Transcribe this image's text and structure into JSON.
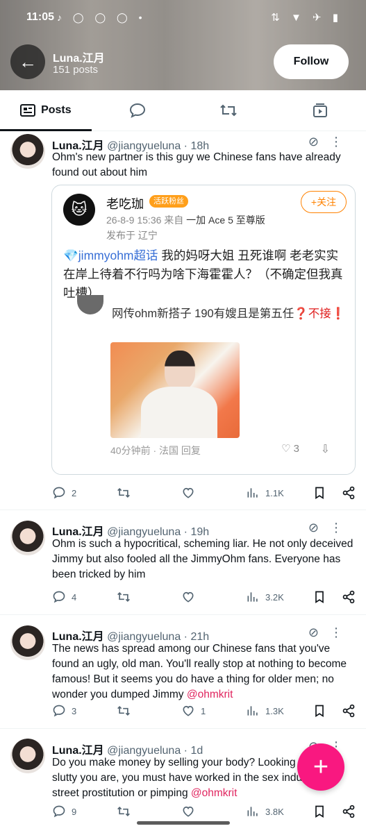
{
  "status_bar": {
    "time": "11:05",
    "apps": "♪ ◯ ◯ ◯ •",
    "right": "⇅ ▼ ✈ ▮"
  },
  "header": {
    "name": "Luna.江月",
    "posts": "151 posts",
    "follow": "Follow",
    "back_icon": "arrow-left-icon"
  },
  "tabs": [
    {
      "label": "Posts",
      "icon": "posts-icon"
    },
    {
      "label": "",
      "icon": "reply-icon"
    },
    {
      "label": "",
      "icon": "retweet-icon"
    },
    {
      "label": "",
      "icon": "media-icon"
    }
  ],
  "posts": [
    {
      "name": "Luna.江月",
      "meta": "@jiangyueluna · 18h",
      "text": "Ohm's new partner is this guy we Chinese fans have already found out about him",
      "mention": "",
      "replies": "2",
      "retweets": "",
      "likes": "",
      "views": "1.1K"
    },
    {
      "name": "Luna.江月",
      "meta": "@jiangyueluna · 19h",
      "text": "Ohm is such a hypocritical, scheming liar. He not only deceived Jimmy but also fooled all the JimmyOhm fans. Everyone has been tricked by him",
      "mention": "",
      "replies": "4",
      "retweets": "",
      "likes": "",
      "views": "3.2K"
    },
    {
      "name": "Luna.江月",
      "meta": "@jiangyueluna · 21h",
      "text": "The news has spread among our Chinese fans that you've found an ugly, old man. You'll really stop at nothing to become famous! But it seems you do have a thing for older men; no wonder you dumped Jimmy ",
      "mention": "@ohmkrit",
      "replies": "3",
      "retweets": "",
      "likes": "1",
      "views": "1.3K"
    },
    {
      "name": "Luna.江月",
      "meta": "@jiangyueluna · 1d",
      "text": "Do you make money by selling your body? Looking at how slutty you are, you must have worked in the sex industry, like street prostitution or pimping ",
      "mention": "@ohmkrit",
      "replies": "9",
      "retweets": "",
      "likes": "",
      "views": "3.8K"
    }
  ],
  "embed": {
    "name": "老吃珈",
    "badge": "活跃粉丝",
    "follow": "+关注",
    "time": "26-8-9 15:36 来自 ",
    "device": "一加 Ace 5 至尊版",
    "location": "发布于 辽宁",
    "topic": "💎jimmyohm超话",
    "text": " 我的妈呀大姐 丑死谁啊 老老实实在岸上待着不行吗为啥下海霍霍人？（不确定但我真吐槽）",
    "repost_text": "网传ohm新搭子 190有嫂且是第五任",
    "warn": "❓不接❗",
    "footer": "40分钟前 · 法国    回复",
    "like_count": "♡ 3",
    "share": "⇩"
  },
  "fab": "+"
}
